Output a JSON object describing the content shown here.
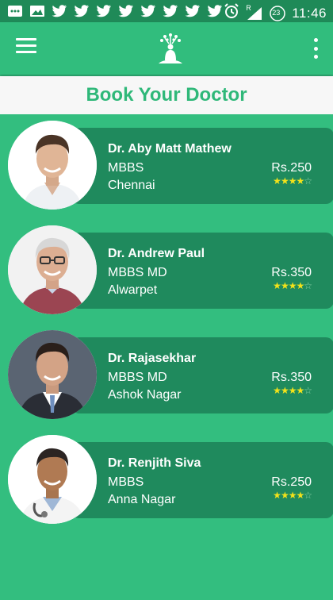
{
  "status_bar": {
    "time": "11:46",
    "network": "R",
    "notification_count": "23",
    "icons": [
      "message-icon",
      "image-icon",
      "twitter-icon",
      "twitter-icon",
      "twitter-icon",
      "twitter-icon",
      "twitter-icon",
      "twitter-icon",
      "twitter-icon",
      "twitter-icon",
      "alarm-icon",
      "signal-icon",
      "battery-icon"
    ]
  },
  "header": {
    "menu_icon": "menu-icon",
    "logo_icon": "meditation-logo-icon",
    "overflow_icon": "more-vert-icon"
  },
  "page": {
    "title": "Book Your Doctor"
  },
  "colors": {
    "primary": "#31bd7d",
    "dark": "#1f8a5d",
    "star": "#f3e21a",
    "title": "#2fb879"
  },
  "doctors": [
    {
      "name": "Dr. Aby Matt Mathew",
      "degree": "MBBS",
      "location": "Chennai",
      "fee": "Rs.250",
      "rating": 4,
      "rating_max": 5
    },
    {
      "name": "Dr. Andrew Paul",
      "degree": "MBBS MD",
      "location": "Alwarpet",
      "fee": "Rs.350",
      "rating": 4,
      "rating_max": 5
    },
    {
      "name": "Dr. Rajasekhar",
      "degree": "MBBS MD",
      "location": "Ashok Nagar",
      "fee": "Rs.350",
      "rating": 4,
      "rating_max": 5
    },
    {
      "name": "Dr. Renjith Siva",
      "degree": "MBBS",
      "location": "Anna Nagar",
      "fee": "Rs.250",
      "rating": 4,
      "rating_max": 5
    }
  ]
}
